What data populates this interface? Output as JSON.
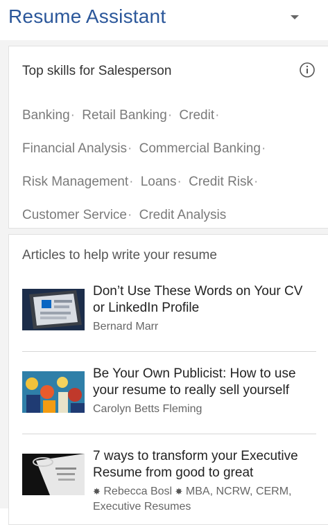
{
  "header": {
    "title": "Resume Assistant"
  },
  "skills_card": {
    "title": "Top skills for Salesperson",
    "skills": [
      "Banking",
      "Retail Banking",
      "Credit",
      "Financial Analysis",
      "Commercial Banking",
      "Risk Management",
      "Loans",
      "Credit Risk",
      "Customer Service",
      "Credit Analysis"
    ],
    "separator": "·"
  },
  "articles_card": {
    "title": "Articles to help write your resume",
    "items": [
      {
        "title": "Don’t Use These Words on Your CV or LinkedIn Profile",
        "author": "Bernard Marr"
      },
      {
        "title": "Be Your Own Publicist: How to use your resume to really sell yourself",
        "author": "Carolyn Betts Fleming"
      },
      {
        "title": "7 ways to transform your Executive Resume from good to great",
        "author_prefix": "Rebecca Bosl",
        "author_suffix": "MBA, NCRW, CERM,",
        "author_extra": "Executive Resumes"
      }
    ]
  },
  "icons": {
    "dropdown": "chevron-down-icon",
    "info": "info-icon",
    "badge": "star-badge-icon"
  },
  "colors": {
    "title": "#2b579a",
    "panel_bg": "#f3f3f3",
    "card_bg": "#ffffff",
    "skill_text": "#7a7a7a"
  }
}
